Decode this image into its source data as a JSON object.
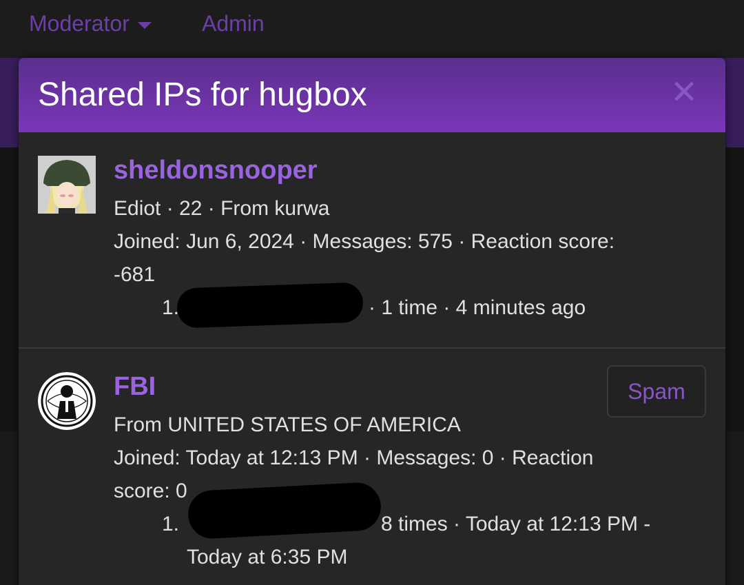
{
  "topnav": {
    "moderator": "Moderator",
    "admin": "Admin"
  },
  "modal": {
    "title": "Shared IPs for hugbox",
    "close": "✕"
  },
  "members": [
    {
      "name": "sheldonsnooper",
      "info": "Ediot · 22 · From kurwa",
      "stats_line1": "Joined: Jun 6, 2024 · Messages: 575 · Reaction score:",
      "stats_line2": "-681",
      "ip_index": "1.",
      "ip_stats": "· 1 time · 4 minutes ago"
    },
    {
      "name": "FBI",
      "info": "From UNITED STATES OF AMERICA",
      "stats_line1": "Joined: Today at 12:13 PM · Messages: 0 · Reaction",
      "stats_line2": "score: 0",
      "ip_index": "1.",
      "ip_stats_line1": "8 times · Today at 12:13 PM -",
      "ip_stats_line2": "Today at 6:35 PM",
      "spam_label": "Spam"
    }
  ],
  "colors": {
    "accent": "#9a63e0",
    "header_top": "#5a2f8c",
    "header_bottom": "#7a36b8"
  }
}
